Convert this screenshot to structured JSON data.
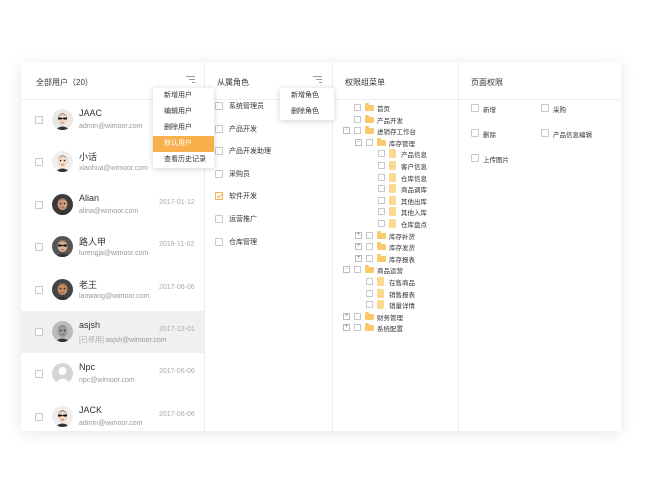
{
  "users_panel": {
    "title": "全部用户（20）",
    "users": [
      {
        "name": "JAAC",
        "email": "admin@wimoor.com",
        "status": "",
        "date": ""
      },
      {
        "name": "小话",
        "email": "xiaohua@wimoor.com",
        "status": "",
        "date": ""
      },
      {
        "name": "Alian",
        "email": "alina@wimoor.com",
        "status": "",
        "date": "2017-01-12"
      },
      {
        "name": "路人甲",
        "email": "lurengja@wimoor.com",
        "status": "",
        "date": "2016-11-02"
      },
      {
        "name": "老王",
        "email": "laowang@wimoor.com",
        "status": "",
        "date": "2017-06-06"
      },
      {
        "name": "asjsh",
        "email": "asjsh@wimoor.com",
        "status": "[已停用]",
        "date": "2017-12-01"
      },
      {
        "name": "Npc",
        "email": "npc@wimoor.com",
        "status": "",
        "date": "2017-06-06"
      },
      {
        "name": "JACK",
        "email": "admin@wimoor.com",
        "status": "",
        "date": "2017-06-06"
      }
    ],
    "menu": [
      "新增用户",
      "编辑用户",
      "删除用户",
      "默认用户",
      "查看历史记录"
    ]
  },
  "roles_panel": {
    "title": "从属角色",
    "roles": [
      {
        "label": "系统管理员",
        "checked": false
      },
      {
        "label": "产品开发",
        "checked": false
      },
      {
        "label": "产品开发助理",
        "checked": false
      },
      {
        "label": "采购员",
        "checked": false
      },
      {
        "label": "软件开发",
        "checked": true
      },
      {
        "label": "运营推广",
        "checked": false
      },
      {
        "label": "仓库管理",
        "checked": false
      }
    ],
    "menu": [
      "新增角色",
      "删除角色"
    ]
  },
  "menu_panel": {
    "title": "权限组菜单",
    "tree": [
      {
        "label": "首页",
        "level": 0,
        "toggle": "",
        "icon": "folder"
      },
      {
        "label": "产品开发",
        "level": 0,
        "toggle": "",
        "icon": "folder"
      },
      {
        "label": "进销存工作台",
        "level": 0,
        "toggle": "-",
        "icon": "folder"
      },
      {
        "label": "库存管理",
        "level": 1,
        "toggle": "-",
        "icon": "folder"
      },
      {
        "label": "产品信息",
        "level": 2,
        "toggle": "",
        "icon": "file"
      },
      {
        "label": "客户信息",
        "level": 2,
        "toggle": "",
        "icon": "file"
      },
      {
        "label": "仓库信息",
        "level": 2,
        "toggle": "",
        "icon": "file"
      },
      {
        "label": "商品调库",
        "level": 2,
        "toggle": "",
        "icon": "file"
      },
      {
        "label": "其他出库",
        "level": 2,
        "toggle": "",
        "icon": "file"
      },
      {
        "label": "其他入库",
        "level": 2,
        "toggle": "",
        "icon": "file"
      },
      {
        "label": "仓库盘点",
        "level": 2,
        "toggle": "",
        "icon": "file"
      },
      {
        "label": "库存补货",
        "level": 1,
        "toggle": "+",
        "icon": "folder"
      },
      {
        "label": "库存发货",
        "level": 1,
        "toggle": "+",
        "icon": "folder"
      },
      {
        "label": "库存报表",
        "level": 1,
        "toggle": "+",
        "icon": "folder"
      },
      {
        "label": "商品运营",
        "level": 0,
        "toggle": "-",
        "icon": "folder"
      },
      {
        "label": "在售商品",
        "level": 1,
        "toggle": "",
        "icon": "file"
      },
      {
        "label": "销售报表",
        "level": 1,
        "toggle": "",
        "icon": "file"
      },
      {
        "label": "销量详情",
        "level": 1,
        "toggle": "",
        "icon": "file"
      },
      {
        "label": "财务管理",
        "level": 0,
        "toggle": "+",
        "icon": "folder"
      },
      {
        "label": "系统配置",
        "level": 0,
        "toggle": "+",
        "icon": "folder"
      }
    ]
  },
  "page_panel": {
    "title": "页面权限",
    "perms": [
      {
        "label": "新增",
        "col": 0
      },
      {
        "label": "采购",
        "col": 1
      },
      {
        "label": "删除",
        "col": 0
      },
      {
        "label": "产品信息编辑",
        "col": 1
      },
      {
        "label": "上传图片",
        "col": 0
      }
    ]
  },
  "colors": {
    "accent": "#f7b04b",
    "folder": "#f9c96b"
  }
}
